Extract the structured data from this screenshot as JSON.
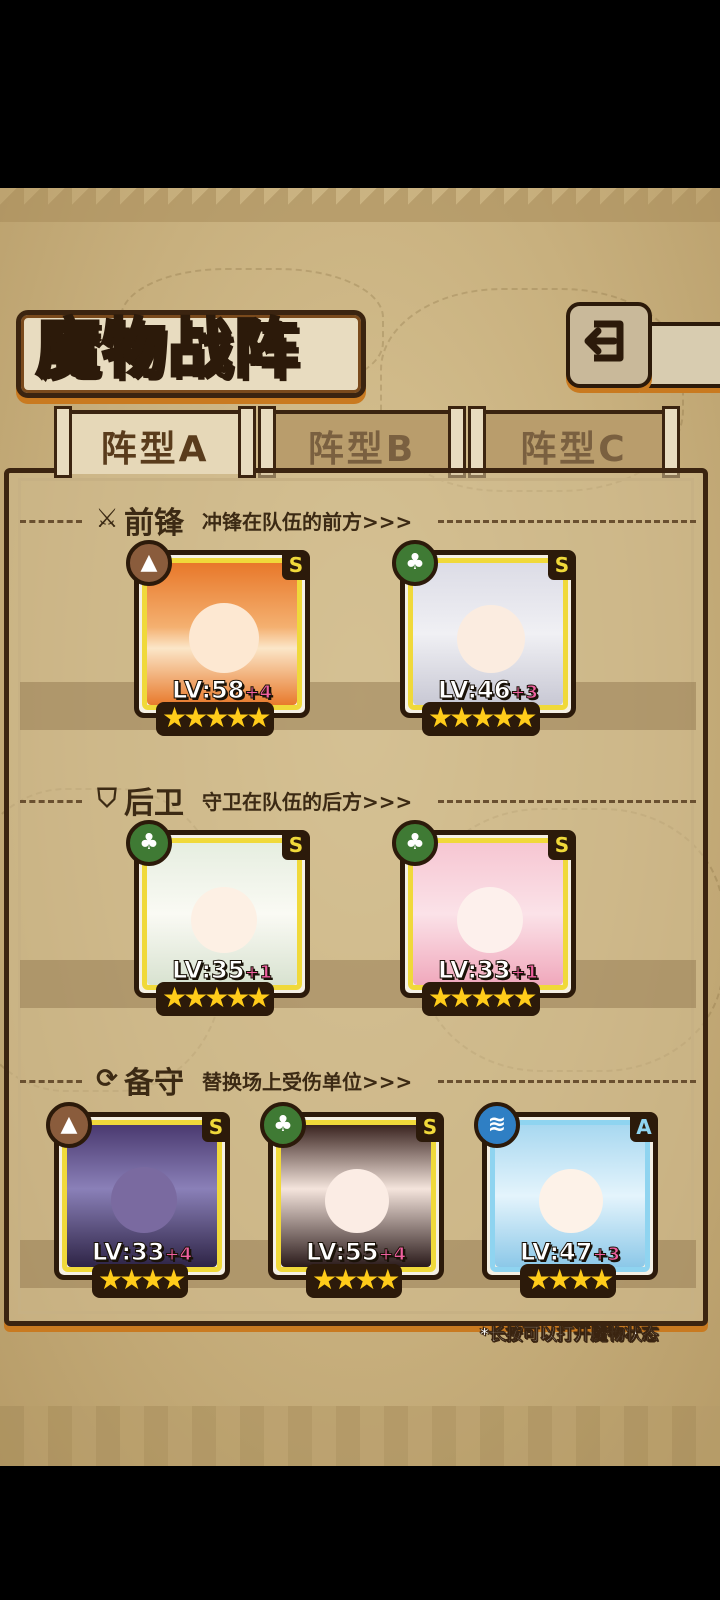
{
  "title": "魔物战阵",
  "back_button_label": "back",
  "tabs": [
    {
      "label": "阵型A",
      "active": true
    },
    {
      "label": "阵型B",
      "active": false
    },
    {
      "label": "阵型C",
      "active": false
    }
  ],
  "sections": [
    {
      "name": "前锋",
      "desc": "冲锋在队伍的前方>>>",
      "icon": "sword-icon",
      "cards": [
        {
          "level": "LV:58",
          "plus": "+4",
          "rank": "S",
          "stars": "★★★★★",
          "element": "earth-icon",
          "palette": "orange"
        },
        {
          "level": "LV:46",
          "plus": "+3",
          "rank": "S",
          "stars": "★★★★★",
          "element": "leaf-icon",
          "palette": "silver"
        }
      ]
    },
    {
      "name": "后卫",
      "desc": "守卫在队伍的后方>>>",
      "icon": "shield-icon",
      "cards": [
        {
          "level": "LV:35",
          "plus": "+1",
          "rank": "S",
          "stars": "★★★★★",
          "element": "leaf-icon",
          "palette": "white"
        },
        {
          "level": "LV:33",
          "plus": "+1",
          "rank": "S",
          "stars": "★★★★★",
          "element": "leaf-icon",
          "palette": "pink"
        }
      ]
    },
    {
      "name": "备守",
      "desc": "替换场上受伤单位>>>",
      "icon": "swap-icon",
      "cards": [
        {
          "level": "LV:33",
          "plus": "+4",
          "rank": "S",
          "stars": "★★★★",
          "element": "earth-icon",
          "palette": "purple"
        },
        {
          "level": "LV:55",
          "plus": "+4",
          "rank": "S",
          "stars": "★★★★",
          "element": "leaf-icon",
          "palette": "dark"
        },
        {
          "level": "LV:47",
          "plus": "+3",
          "rank": "A",
          "stars": "★★★★",
          "element": "water-icon",
          "palette": "blue"
        }
      ]
    }
  ],
  "hint": "*长按可以打开魔物状态",
  "colors": {
    "frame": "#3b2410",
    "accent": "#c97a20",
    "gold_border": "#f0d93a",
    "plus": "#f060a0"
  }
}
